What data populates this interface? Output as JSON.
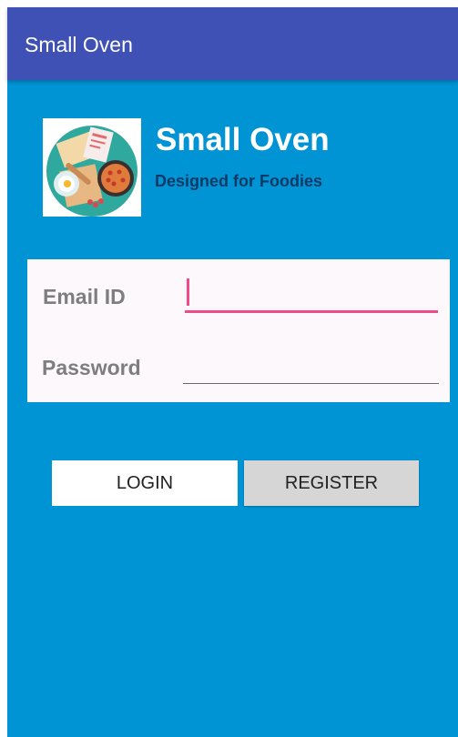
{
  "app_bar": {
    "title": "Small Oven"
  },
  "brand": {
    "logo_icon": "food-plate-logo-icon",
    "title": "Small Oven",
    "tagline": "Designed for Foodies"
  },
  "form": {
    "email": {
      "label": "Email ID",
      "value": "",
      "placeholder": ""
    },
    "password": {
      "label": "Password",
      "value": "",
      "placeholder": ""
    }
  },
  "buttons": {
    "login": "LOGIN",
    "register": "REGISTER"
  },
  "colors": {
    "app_bar": "#3f51b5",
    "background": "#0094d5",
    "accent": "#ef4a8a",
    "tagline": "#0b3a66"
  }
}
